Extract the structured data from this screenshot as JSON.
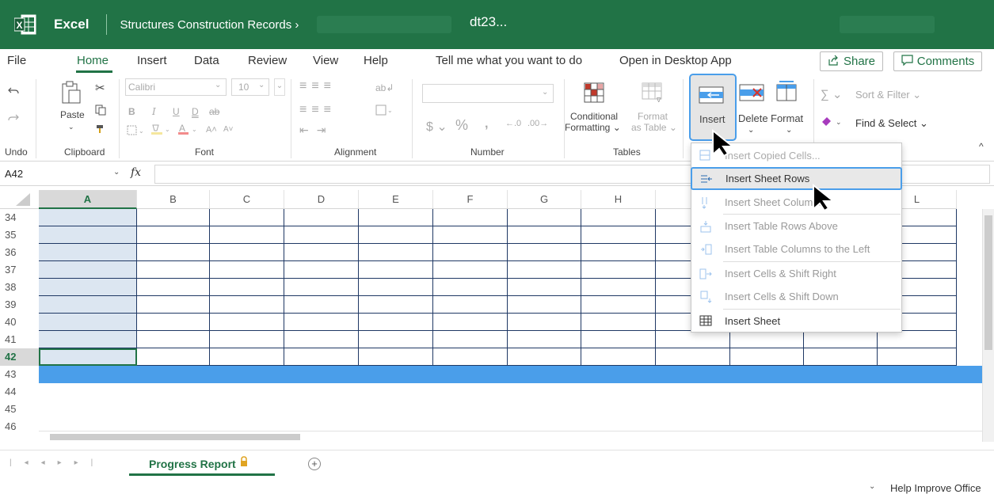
{
  "titlebar": {
    "app_name": "Excel",
    "breadcrumb": "Structures Construction Records ›",
    "filename": "dt23..."
  },
  "menu": {
    "items": [
      "File",
      "Home",
      "Insert",
      "Data",
      "Review",
      "View",
      "Help",
      "Tell me what you want to do",
      "Open in Desktop App"
    ],
    "share": "Share",
    "comments": "Comments"
  },
  "ribbon": {
    "undo_label": "Undo",
    "clipboard": {
      "paste": "Paste",
      "label": "Clipboard"
    },
    "font": {
      "name": "Calibri",
      "size": "10",
      "label": "Font"
    },
    "alignment_label": "Alignment",
    "number_label": "Number",
    "tables": {
      "conditional_1": "Conditional",
      "conditional_2": "Formatting",
      "format_1": "Format",
      "format_2": "as Table",
      "label": "Tables"
    },
    "cells": {
      "insert": "Insert",
      "delete": "Delete",
      "format": "Format"
    },
    "editing": {
      "sort_filter": "Sort & Filter",
      "find_select": "Find & Select"
    }
  },
  "formula": {
    "name_box": "A42",
    "fx": "fx"
  },
  "columns": [
    "A",
    "B",
    "C",
    "D",
    "E",
    "F",
    "G",
    "H",
    "I",
    "J",
    "K",
    "L"
  ],
  "rows": [
    "34",
    "35",
    "36",
    "37",
    "38",
    "39",
    "40",
    "41",
    "42",
    "43",
    "44",
    "45",
    "46"
  ],
  "insert_menu": {
    "items": [
      "Insert Copied Cells...",
      "Insert Sheet Rows",
      "Insert Sheet Columns",
      "Insert Table Rows Above",
      "Insert Table Columns to the Left",
      "Insert Cells & Shift Right",
      "Insert Cells & Shift Down",
      "Insert Sheet"
    ]
  },
  "sheet": {
    "tab": "Progress Report"
  },
  "status": {
    "help": "Help Improve Office"
  },
  "colors": {
    "accent": "#217346",
    "selection": "#dce6f1",
    "highlight": "#4a9eea"
  }
}
